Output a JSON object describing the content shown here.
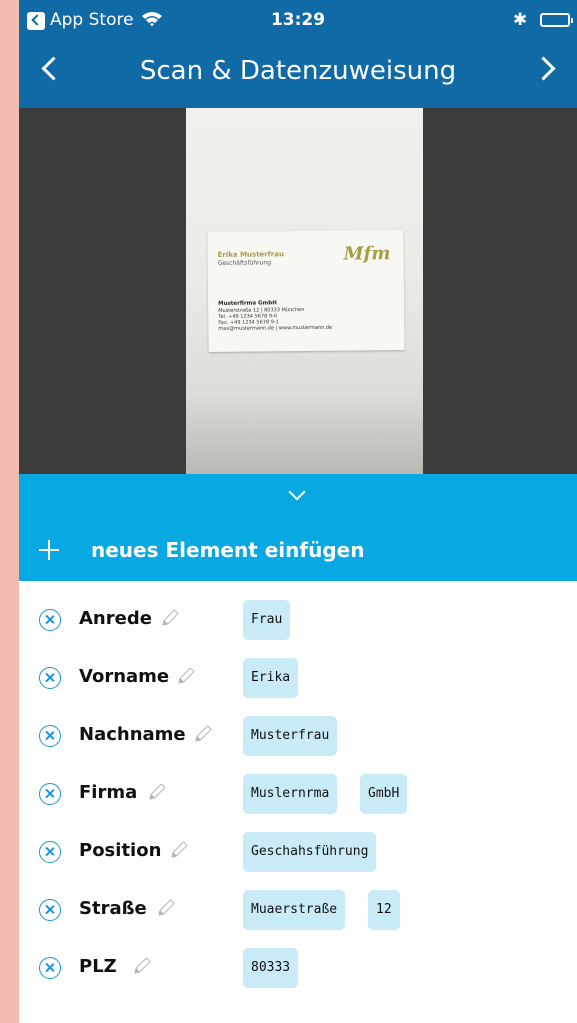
{
  "status_bar": {
    "back_label": "App Store",
    "time": "13:29",
    "bluetooth": "✱"
  },
  "nav": {
    "title": "Scan & Datenzuweisung"
  },
  "card": {
    "name": "Erika Musterfrau",
    "role": "Geschäftsführung",
    "logo": "Mfm",
    "company": "Musterfirma GmbH",
    "lines": [
      "Musterstraße 12 | 80333 München",
      "Tel. +49 1234 5678 9-0",
      "Fax. +49 1234 5678 9-1",
      "max@mustermann.de | www.mustermann.de"
    ]
  },
  "add_element": {
    "label": "neues Element einfügen"
  },
  "fields": [
    {
      "label": "Anrede",
      "values": [
        "Frau"
      ]
    },
    {
      "label": "Vorname",
      "values": [
        "Erika"
      ]
    },
    {
      "label": "Nachname",
      "values": [
        "Musterfrau"
      ]
    },
    {
      "label": "Firma",
      "values": [
        "Muslernrma",
        "GmbH"
      ]
    },
    {
      "label": "Position",
      "values": [
        "Geschahsführung"
      ]
    },
    {
      "label": "Straße",
      "values": [
        "Muaerstraße",
        "12"
      ]
    },
    {
      "label": "PLZ",
      "values": [
        "80333"
      ]
    }
  ],
  "colors": {
    "nav_blue": "#0f6aa6",
    "accent_blue": "#08a9e2",
    "chip_blue": "#c9ebf7"
  }
}
